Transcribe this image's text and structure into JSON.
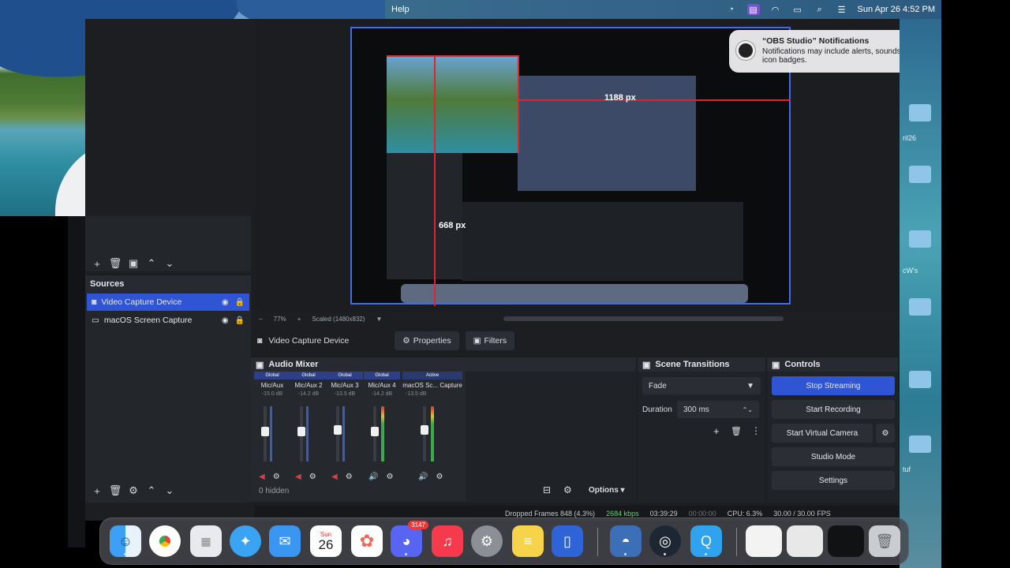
{
  "menubar": {
    "help": "Help",
    "datetime": "Sun Apr 26  4:52 PM",
    "icons": [
      "notification-center-icon",
      "screen-mirroring-icon",
      "wifi-icon",
      "battery-icon",
      "spotlight-icon",
      "control-center-icon"
    ]
  },
  "notification": {
    "title": "“OBS Studio” Notifications",
    "body": "Notifications may include alerts, sounds, and icon badges."
  },
  "preview": {
    "measure_w": "1188 px",
    "measure_h": "668 px",
    "zoom": "77%",
    "scaled": "Scaled (1480x832)"
  },
  "sources": {
    "header": "Sources",
    "items": [
      {
        "label": "Video Capture Device",
        "selected": true
      },
      {
        "label": "macOS Screen Capture",
        "selected": false
      }
    ]
  },
  "propbar": {
    "source": "Video Capture Device",
    "properties": "Properties",
    "filters": "Filters"
  },
  "mixer": {
    "header": "Audio Mixer",
    "channels": [
      {
        "tag": "Global",
        "name": "Mic/Aux",
        "db": "-15.0 dB",
        "muted": true
      },
      {
        "tag": "Global",
        "name": "Mic/Aux 2",
        "db": "-14.2 dB",
        "muted": true
      },
      {
        "tag": "Global",
        "name": "Mic/Aux 3",
        "db": "-13.5 dB",
        "muted": true
      },
      {
        "tag": "Global",
        "name": "Mic/Aux 4",
        "db": "-14.2 dB",
        "muted": false
      },
      {
        "tag": "Active",
        "name": "macOS Sc... Capture",
        "db": "-13.5 dB",
        "muted": false
      }
    ],
    "hidden": "0 hidden",
    "options": "Options"
  },
  "transitions": {
    "header": "Scene Transitions",
    "type": "Fade",
    "duration_label": "Duration",
    "duration": "300 ms"
  },
  "controls": {
    "header": "Controls",
    "stop_streaming": "Stop Streaming",
    "start_recording": "Start Recording",
    "start_virtual": "Start Virtual Camera",
    "studio_mode": "Studio Mode",
    "settings": "Settings"
  },
  "status": {
    "dropped": "Dropped Frames 848 (4.3%)",
    "bitrate": "2684 kbps",
    "live": "03:39:29",
    "rec": "00:00:00",
    "cpu": "CPU: 6.3%",
    "fps": "30.00 / 30.00 FPS"
  },
  "desktop": {
    "labels": [
      "ril26",
      "cW's",
      "tuf"
    ]
  },
  "dock": {
    "date_day": "Sun",
    "date_num": "26",
    "discord_badge": "3147"
  }
}
